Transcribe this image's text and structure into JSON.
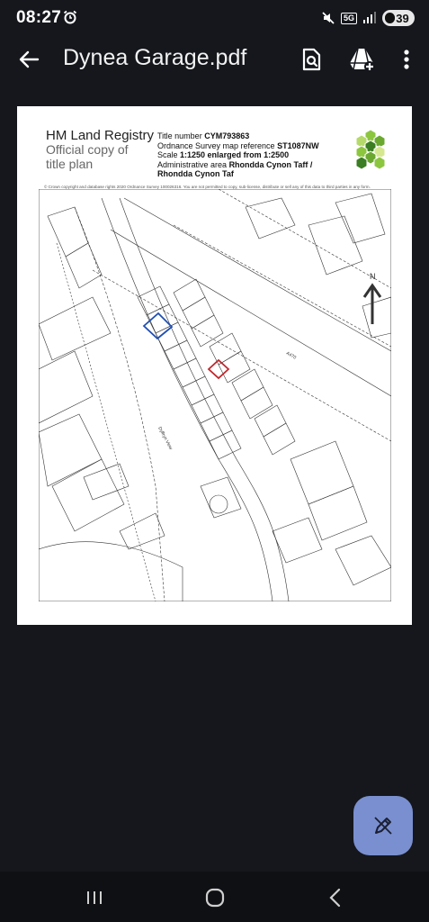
{
  "status_bar": {
    "time": "08:27",
    "network": "5G",
    "battery": "39"
  },
  "app_bar": {
    "title": "Dynea Garage.pdf",
    "icons": [
      "back-arrow-icon",
      "search-document-icon",
      "drive-add-icon",
      "more-vert-icon"
    ]
  },
  "document": {
    "registry_name": "HM Land Registry",
    "subtitle_line1": "Official copy of",
    "subtitle_line2": "title plan",
    "title_number_label": "Title number",
    "title_number": "CYM793863",
    "os_ref_label": "Ordnance Survey map reference",
    "os_ref": "ST1087NW",
    "scale_label": "Scale",
    "scale": "1:1250 enlarged from 1:2500",
    "admin_area_label": "Administrative area",
    "admin_area_line1": "Rhondda Cynon Taff /",
    "admin_area_line2": "Rhondda Cynon Taf",
    "copyright": "© Crown copyright and database rights 2020 Ordnance Survey 100026316. You are not permitted to copy, sub-license, distribute or sell any of this data to third parties in any form.",
    "north_label": "N",
    "road_label": "A470",
    "street_label": "Dyffryn View",
    "colors": {
      "red_parcel": "#c0272d",
      "blue_parcel": "#1f4fb5",
      "logo_green": "#8cc63f"
    }
  },
  "fab": {
    "icon": "edit-pen-icon"
  },
  "nav_bar": {
    "icons": [
      "recent-apps-icon",
      "home-icon",
      "back-icon"
    ]
  }
}
